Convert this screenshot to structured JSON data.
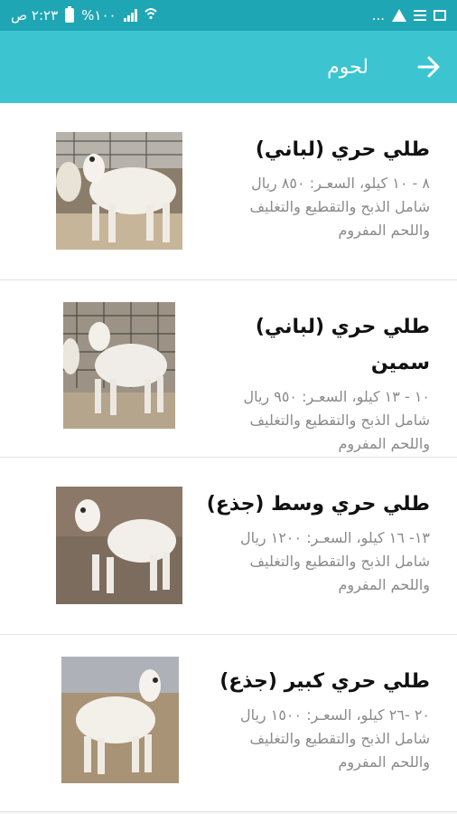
{
  "status_bar": {
    "time": "٢:٢٣ ص",
    "battery_text": "%١٠٠",
    "overflow": "...",
    "icons": [
      "battery-icon",
      "signal-icon",
      "wifi-icon",
      "warning-icon",
      "notification-list-icon",
      "image-icon"
    ]
  },
  "app_bar": {
    "title": "لحوم",
    "back_icon": "arrow-right-icon"
  },
  "colors": {
    "status_bar": "#1fa6b4",
    "app_bar": "#3cc4d1"
  },
  "products": [
    {
      "title": "طلي حري (لباني)",
      "desc_line1": "٨ - ١٠ كيلو، السعـر: ٨٥٠ ريال",
      "desc_line2": "شامل الذبح والتقطيع والتغليف",
      "desc_line3": "واللحم المفروم"
    },
    {
      "title": "طلي حري (لباني) سمين",
      "desc_line1": "١٠ - ١٣ كيلو، السعـر: ٩٥٠ ريال",
      "desc_line2": "شامل الذبح والتقطيع والتغليف",
      "desc_line3": "واللحم المفروم"
    },
    {
      "title": "طلي حري وسط (جذع)",
      "desc_line1": "١٣- ١٦ كيلو، السعـر: ١٢٠٠ ريال",
      "desc_line2": "شامل الذبح والتقطيع والتغليف",
      "desc_line3": "واللحم المفروم"
    },
    {
      "title": "طلي حري كبير (جذع)",
      "desc_line1": "٢٠ -٢٦ كيلو، السعـر: ١٥٠٠ ريال",
      "desc_line2": "شامل الذبح والتقطيع والتغليف",
      "desc_line3": "واللحم المفروم"
    }
  ]
}
